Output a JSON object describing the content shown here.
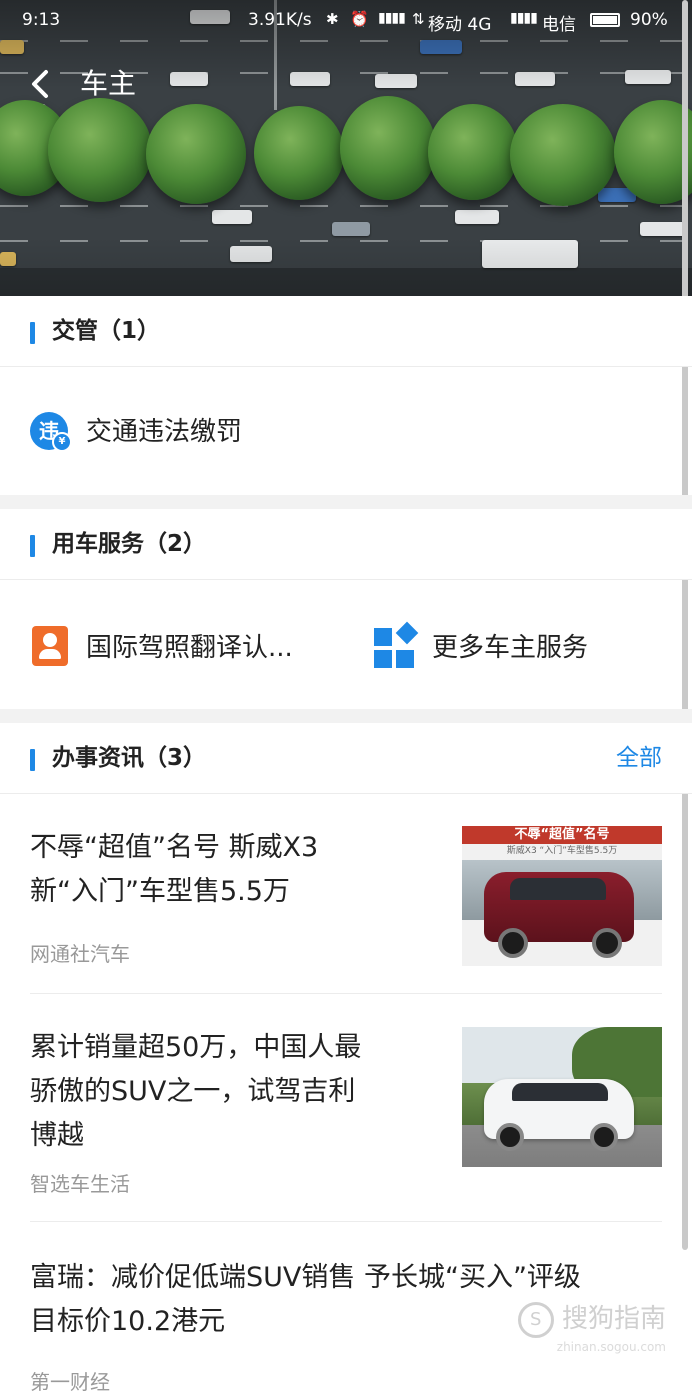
{
  "status_bar": {
    "time": "9:13",
    "speed": "3.91K/s",
    "carrier1": "移动 4G",
    "carrier2": "电信",
    "battery": "90%"
  },
  "nav": {
    "title": "车主"
  },
  "sections": {
    "traffic": {
      "title": "交管（1）",
      "item_label": "交通违法缴罚",
      "icon_text": "违"
    },
    "car_service": {
      "title": "用车服务（2）",
      "items": [
        {
          "label": "国际驾照翻译认..."
        },
        {
          "label": "更多车主服务"
        }
      ]
    },
    "news": {
      "title": "办事资讯（3）",
      "more": "全部",
      "items": [
        {
          "line1": "不辱“超值”名号 斯威X3",
          "line2": "新“入门”车型售5.5万",
          "source": "网通社汽车",
          "thumb_banner": "不辱“超值”名号",
          "thumb_sub": "斯威X3 “入门”车型售5.5万"
        },
        {
          "line1": "累计销量超50万，中国人最",
          "line2": "骄傲的SUV之一，试驾吉利",
          "line3": "博越",
          "source": "智选车生活"
        },
        {
          "line1": "富瑞：减价促低端SUV销售 予长城“买入”评级",
          "line2": "目标价10.2港元",
          "source": "第一财经"
        }
      ]
    }
  },
  "watermark": {
    "text": "搜狗指南",
    "sub": "zhinan.sogou.com"
  }
}
